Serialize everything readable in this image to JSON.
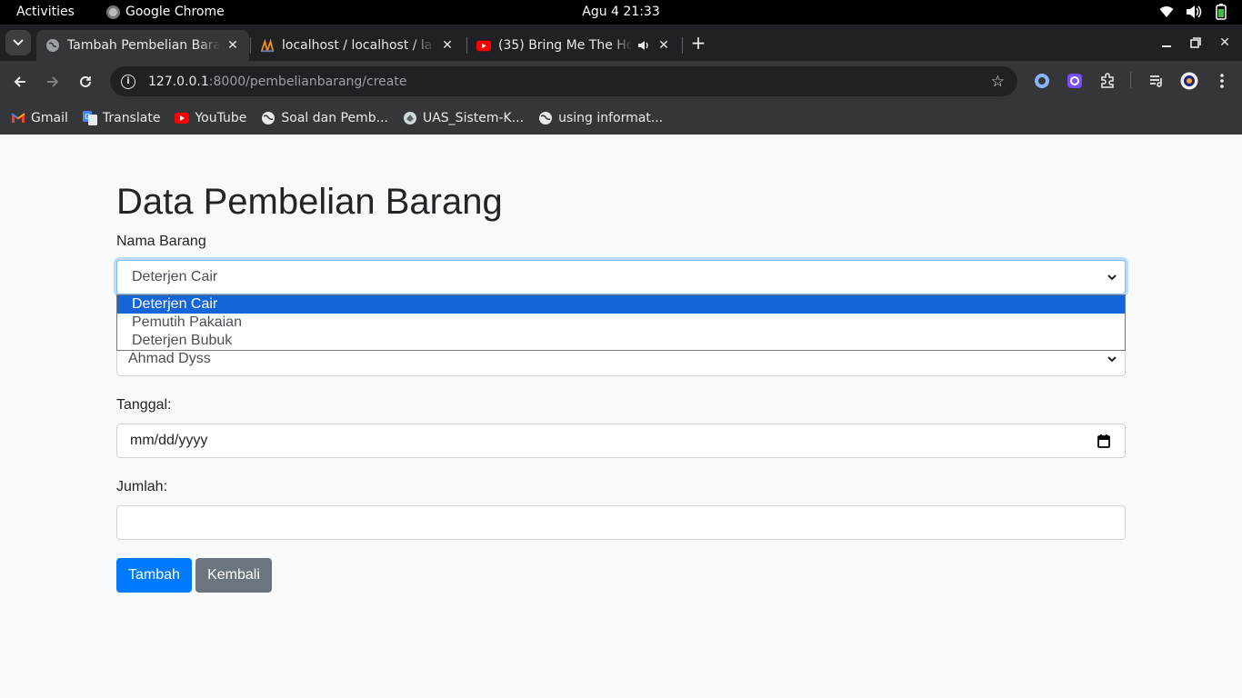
{
  "os_bar": {
    "activities": "Activities",
    "app_name": "Google Chrome",
    "clock": "Agu 4  21:33"
  },
  "tabs": [
    {
      "title": "Tambah Pembelian Barang",
      "active": true,
      "favicon": "globe-icon"
    },
    {
      "title": "localhost / localhost / laravel",
      "active": false,
      "favicon": "phpmyadmin-icon"
    },
    {
      "title": "(35) Bring Me The Horizon",
      "active": false,
      "favicon": "youtube-icon",
      "audio": true
    }
  ],
  "address_bar": {
    "host": "127.0.0.1",
    "path": ":8000/pembelianbarang/create"
  },
  "bookmarks": [
    {
      "label": "Gmail",
      "icon": "gmail-icon"
    },
    {
      "label": "Translate",
      "icon": "translate-icon"
    },
    {
      "label": "YouTube",
      "icon": "youtube-icon"
    },
    {
      "label": "Soal dan Pemb...",
      "icon": "globe-icon"
    },
    {
      "label": "UAS_Sistem-K...",
      "icon": "university-icon"
    },
    {
      "label": "using informat...",
      "icon": "globe-icon"
    }
  ],
  "form": {
    "title": "Data Pembelian Barang",
    "nama_barang_label": "Nama Barang",
    "nama_barang_value": "Deterjen Cair",
    "nama_barang_options": [
      "Deterjen Cair",
      "Pemutih Pakaian",
      "Deterjen Bubuk"
    ],
    "second_select_value": "Ahmad Dyss",
    "tanggal_label": "Tanggal:",
    "tanggal_placeholder": "mm/dd/yyyy",
    "jumlah_label": "Jumlah:",
    "jumlah_value": "",
    "submit_label": "Tambah",
    "back_label": "Kembali"
  },
  "colors": {
    "primary": "#007bff",
    "secondary": "#6c757d",
    "selected_option": "#1565d8"
  }
}
